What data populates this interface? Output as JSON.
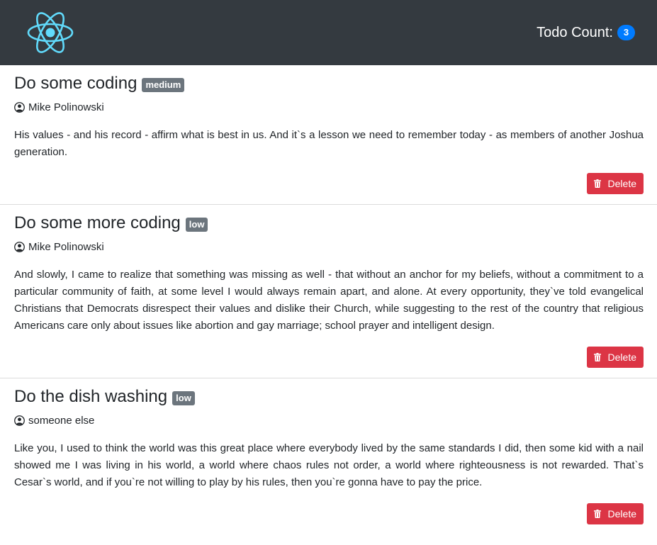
{
  "header": {
    "logo_icon": "react-atom-icon",
    "count_label": "Todo Count:",
    "count_value": "3",
    "colors": {
      "navbar": "#343a40",
      "logo": "#61dafb",
      "count_badge": "#007bff"
    }
  },
  "todos": [
    {
      "title": "Do some coding",
      "priority": "medium",
      "owner": "Mike Polinowski",
      "description": "His values - and his record - affirm what is best in us. And it`s a lesson we need to remember today - as members of another Joshua generation.",
      "delete_label": "Delete"
    },
    {
      "title": "Do some more coding",
      "priority": "low",
      "owner": "Mike Polinowski",
      "description": "And slowly, I came to realize that something was missing as well - that without an anchor for my beliefs, without a commitment to a particular community of faith, at some level I would always remain apart, and alone. At every opportunity, they`ve told evangelical Christians that Democrats disrespect their values and dislike their Church, while suggesting to the rest of the country that religious Americans care only about issues like abortion and gay marriage; school prayer and intelligent design.",
      "delete_label": "Delete"
    },
    {
      "title": "Do the dish washing",
      "priority": "low",
      "owner": "someone else",
      "description": "Like you, I used to think the world was this great place where everybody lived by the same standards I did, then some kid with a nail showed me I was living in his world, a world where chaos rules not order, a world where righteousness is not rewarded. That`s Cesar`s world, and if you`re not willing to play by his rules, then you`re gonna have to pay the price.",
      "delete_label": "Delete"
    }
  ],
  "colors": {
    "priority_badge": "#6c757d",
    "delete_button": "#dc3545"
  }
}
